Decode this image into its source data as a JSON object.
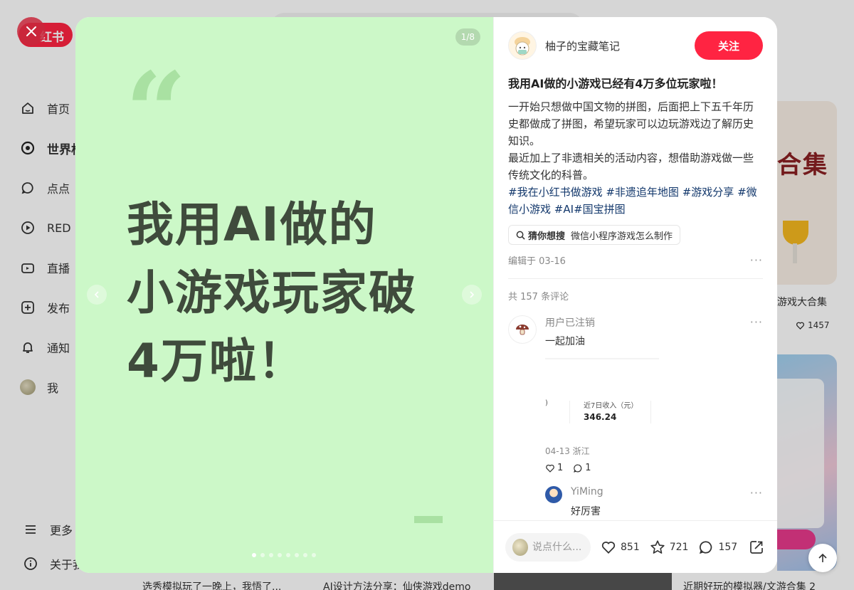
{
  "background": {
    "logo_text": "红书",
    "nav": [
      {
        "label": "首页",
        "icon": "home-icon"
      },
      {
        "label": "世界杯",
        "icon": "soccer-icon"
      },
      {
        "label": "点点",
        "icon": "chat-bubble-icon"
      },
      {
        "label": "RED",
        "icon": "play-icon"
      },
      {
        "label": "直播",
        "icon": "live-icon"
      },
      {
        "label": "发布",
        "icon": "plus-icon"
      },
      {
        "label": "通知",
        "icon": "bell-icon"
      },
      {
        "label": "我",
        "icon": "avatar"
      }
    ],
    "bottom_nav": [
      {
        "label": "更多",
        "icon": "menu-icon"
      },
      {
        "label": "关于我们",
        "icon": "info-icon"
      }
    ],
    "right_card_1": {
      "cover_text": "合集",
      "title": "游戏大合集",
      "likes": "1457"
    },
    "bottom_titles": [
      "选秀模拟玩了一晚上，我悟了...",
      "AI设计方法分享：仙侠游戏demo",
      "近期好玩的模拟器/文游合集 2"
    ]
  },
  "media": {
    "page_counter": "1/8",
    "quote_mark": "“",
    "cover_lines": [
      "我用AI做的",
      "小游戏玩家破",
      "4万啦！"
    ],
    "total_pages": 8,
    "current_page": 1
  },
  "author": {
    "name": "柚子的宝藏笔记",
    "follow_label": "关注"
  },
  "note": {
    "title": "我用AI做的小游戏已经有4万多位玩家啦！",
    "desc_1": "一开始只想做中国文物的拼图，后面把上下五千年历史都做成了拼图，希望玩家可以边玩游戏边了解历史知识。",
    "desc_2": "最近加上了非遗相关的活动内容，想借助游戏做一些传统文化的科普。",
    "tags": [
      "#我在小红书做游戏",
      "#非遗追年地图",
      "#游戏分享",
      "#微信小游戏",
      "#AI",
      "#国宝拼图"
    ],
    "guess_label": "猜你想搜",
    "guess_query": "微信小程序游戏怎么制作",
    "edited": "编辑于 03-16",
    "comment_count": "共 157 条评论"
  },
  "comments": [
    {
      "name": "用户已注销",
      "text": "一起加油",
      "image": {
        "left_label": ")",
        "label": "近7日收入（元）",
        "value": "346.24"
      },
      "meta": "04-13 浙江",
      "likes": "1",
      "replies": "1"
    }
  ],
  "reply": {
    "name": "YiMing",
    "text": "好厉害"
  },
  "bottom_bar": {
    "placeholder": "说点什么...",
    "likes": "851",
    "collects": "721",
    "comments": "157"
  },
  "colors": {
    "brand": "#ff2442",
    "cover_bg": "#ccf8c8",
    "tag": "#13386c"
  }
}
